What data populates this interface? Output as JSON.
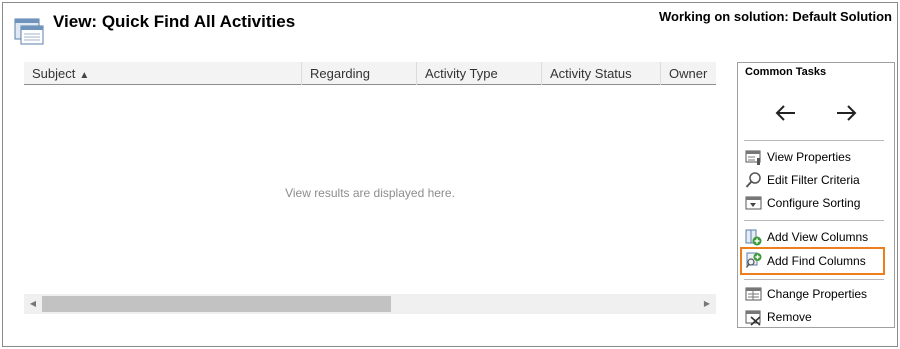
{
  "header": {
    "title": "View: Quick Find All Activities",
    "solution_label": "Working on solution: Default Solution",
    "icon": "view-icon"
  },
  "grid": {
    "columns": [
      {
        "label": "Subject",
        "sorted": "ascending"
      },
      {
        "label": "Regarding"
      },
      {
        "label": "Activity Type"
      },
      {
        "label": "Activity Status"
      },
      {
        "label": "Owner"
      }
    ],
    "empty_message": "View results are displayed here.",
    "scroll_left_icon": "triangle-left-icon",
    "scroll_right_icon": "triangle-right-icon"
  },
  "common_tasks": {
    "title": "Common Tasks",
    "nav": {
      "left_icon": "arrow-left-icon",
      "right_icon": "arrow-right-icon"
    },
    "items": [
      {
        "label": "View Properties",
        "icon": "view-properties-icon"
      },
      {
        "label": "Edit Filter Criteria",
        "icon": "magnifier-icon"
      },
      {
        "label": "Configure Sorting",
        "icon": "sorting-icon"
      },
      {
        "label": "Add View Columns",
        "icon": "add-view-columns-icon"
      },
      {
        "label": "Add Find Columns",
        "icon": "add-find-columns-icon",
        "highlighted": true
      },
      {
        "label": "Change Properties",
        "icon": "change-properties-icon"
      },
      {
        "label": "Remove",
        "icon": "remove-icon"
      }
    ],
    "highlight_color": "#ee7d1c"
  }
}
